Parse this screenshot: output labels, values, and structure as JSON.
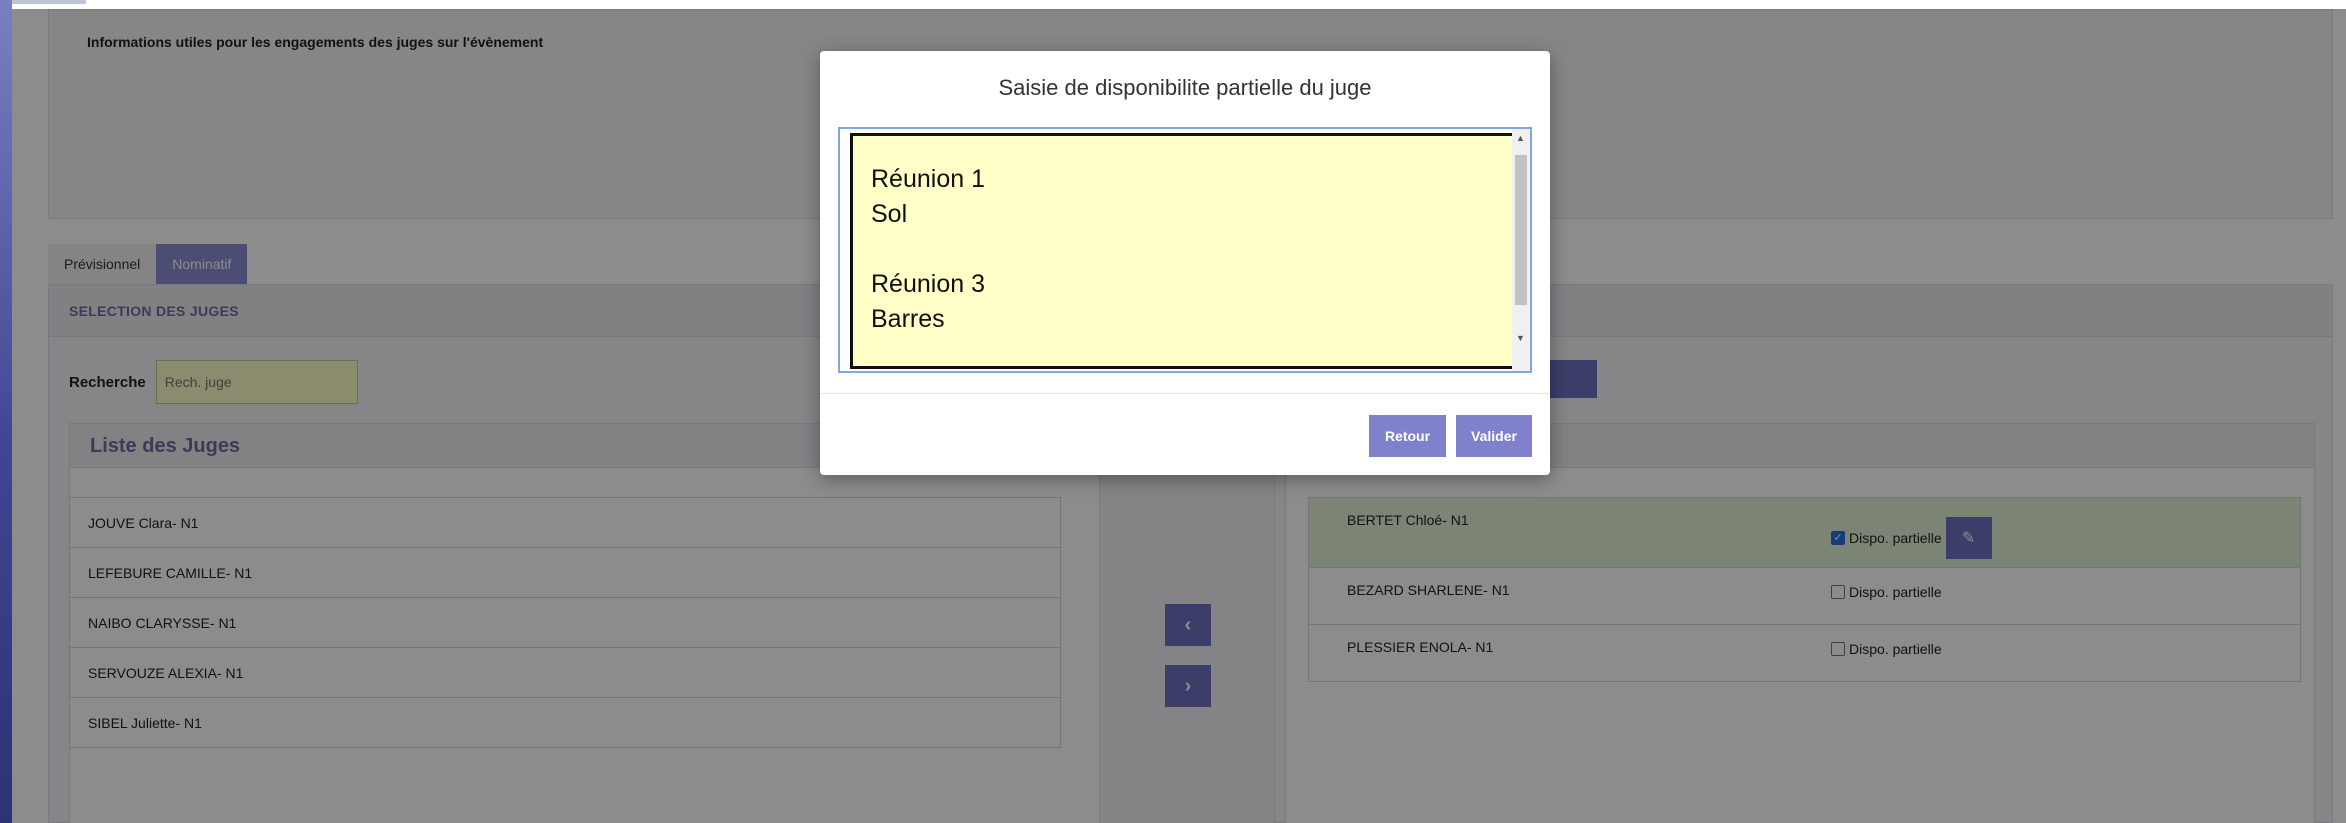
{
  "info": {
    "text": "Informations utiles pour les engagements des juges sur l'évènement"
  },
  "tabs": [
    {
      "label": "Prévisionnel",
      "active": false
    },
    {
      "label": "Nominatif",
      "active": true
    }
  ],
  "selection": {
    "header": "SELECTION DES JUGES",
    "search_label": "Recherche",
    "search_placeholder": "Rech. juge"
  },
  "liste_juges": {
    "title": "Liste des Juges",
    "items": [
      "JOUVE Clara- N1",
      "LEFEBURE CAMILLE- N1",
      "NAIBO CLARYSSE- N1",
      "SERVOUZE ALEXIA- N1",
      "SIBEL Juliette- N1"
    ]
  },
  "arrows": {
    "left": "‹",
    "right": "›"
  },
  "selected_juges": [
    {
      "name": "BERTET Chloé- N1",
      "dispo_label": "Dispo. partielle",
      "checked": true
    },
    {
      "name": "BEZARD SHARLENE- N1",
      "dispo_label": "Dispo. partielle",
      "checked": false
    },
    {
      "name": "PLESSIER ENOLA- N1",
      "dispo_label": "Dispo. partielle",
      "checked": false
    }
  ],
  "modal": {
    "title": "Saisie de disponibilite partielle du juge",
    "textarea_value": "Réunion 1\nSol\n\nRéunion 3\nBarres",
    "retour_label": "Retour",
    "valider_label": "Valider"
  },
  "colors": {
    "accent": "#7f81cc",
    "highlight_row": "#e2f0d8",
    "search_bg": "#fdfdc8"
  },
  "icons": {
    "edit": "pencil-icon",
    "arrow_left": "chevron-left-icon",
    "arrow_right": "chevron-right-icon"
  }
}
